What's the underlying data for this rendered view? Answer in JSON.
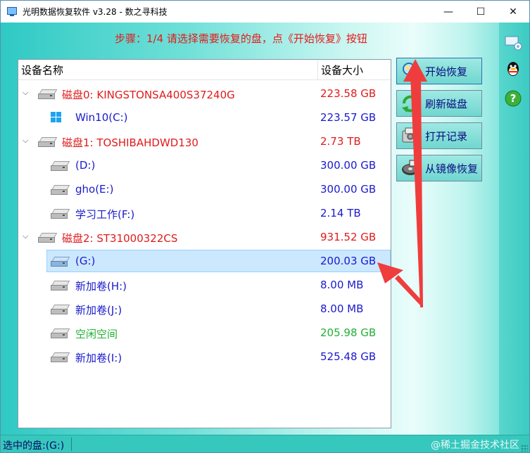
{
  "window": {
    "title": "光明数据恢复软件 v3.28 - 数之寻科技",
    "controls": [
      "minimize",
      "maximize",
      "close"
    ]
  },
  "step_text": "步骤：1/4 请选择需要恢复的盘，点《开始恢复》按钮",
  "table": {
    "headers": [
      "设备名称",
      "设备大小"
    ],
    "rows": [
      {
        "name": "磁盘0: KINGSTONSA400S37240G",
        "size": "223.58 GB",
        "level": 0,
        "color": "red",
        "icon": "disk-icon",
        "expanded": true
      },
      {
        "name": "Win10(C:)",
        "size": "223.57 GB",
        "level": 1,
        "color": "blue",
        "icon": "windows-icon"
      },
      {
        "name": "磁盘1: TOSHIBAHDWD130",
        "size": "2.73 TB",
        "level": 0,
        "color": "red",
        "icon": "disk-icon",
        "expanded": true
      },
      {
        "name": "(D:)",
        "size": "300.00 GB",
        "level": 1,
        "color": "blue",
        "icon": "disk-icon"
      },
      {
        "name": "gho(E:)",
        "size": "300.00 GB",
        "level": 1,
        "color": "blue",
        "icon": "disk-icon"
      },
      {
        "name": "学习工作(F:)",
        "size": "2.14 TB",
        "level": 1,
        "color": "blue",
        "icon": "disk-icon"
      },
      {
        "name": "磁盘2: ST31000322CS",
        "size": "931.52 GB",
        "level": 0,
        "color": "red",
        "icon": "disk-icon",
        "expanded": true
      },
      {
        "name": "(G:)",
        "size": "200.03 GB",
        "level": 1,
        "color": "blue",
        "icon": "disk-icon",
        "selected": true
      },
      {
        "name": "新加卷(H:)",
        "size": "8.00 MB",
        "level": 1,
        "color": "blue",
        "icon": "disk-icon"
      },
      {
        "name": "新加卷(J:)",
        "size": "8.00 MB",
        "level": 1,
        "color": "blue",
        "icon": "disk-icon"
      },
      {
        "name": "空闲空间",
        "size": "205.98 GB",
        "level": 1,
        "color": "green",
        "icon": "disk-icon"
      },
      {
        "name": "新加卷(I:)",
        "size": "525.48 GB",
        "level": 1,
        "color": "blue",
        "icon": "disk-icon"
      }
    ]
  },
  "buttons": [
    {
      "label": "开始恢复",
      "icon": "magnifier-icon"
    },
    {
      "label": "刷新磁盘",
      "icon": "refresh-icon"
    },
    {
      "label": "打开记录",
      "icon": "folder-icon"
    },
    {
      "label": "从镜像恢复",
      "icon": "image-disk-icon"
    }
  ],
  "side_icons": [
    "network-icon",
    "qq-icon",
    "help-icon"
  ],
  "status": {
    "text": "选中的盘:(G:)",
    "watermark": "@稀土掘金技术社区"
  },
  "colors": {
    "red_text": "#e01b1b",
    "blue_text": "#1a1acc",
    "green_text": "#22b034",
    "annotation_arrow": "#ef3d3d"
  }
}
